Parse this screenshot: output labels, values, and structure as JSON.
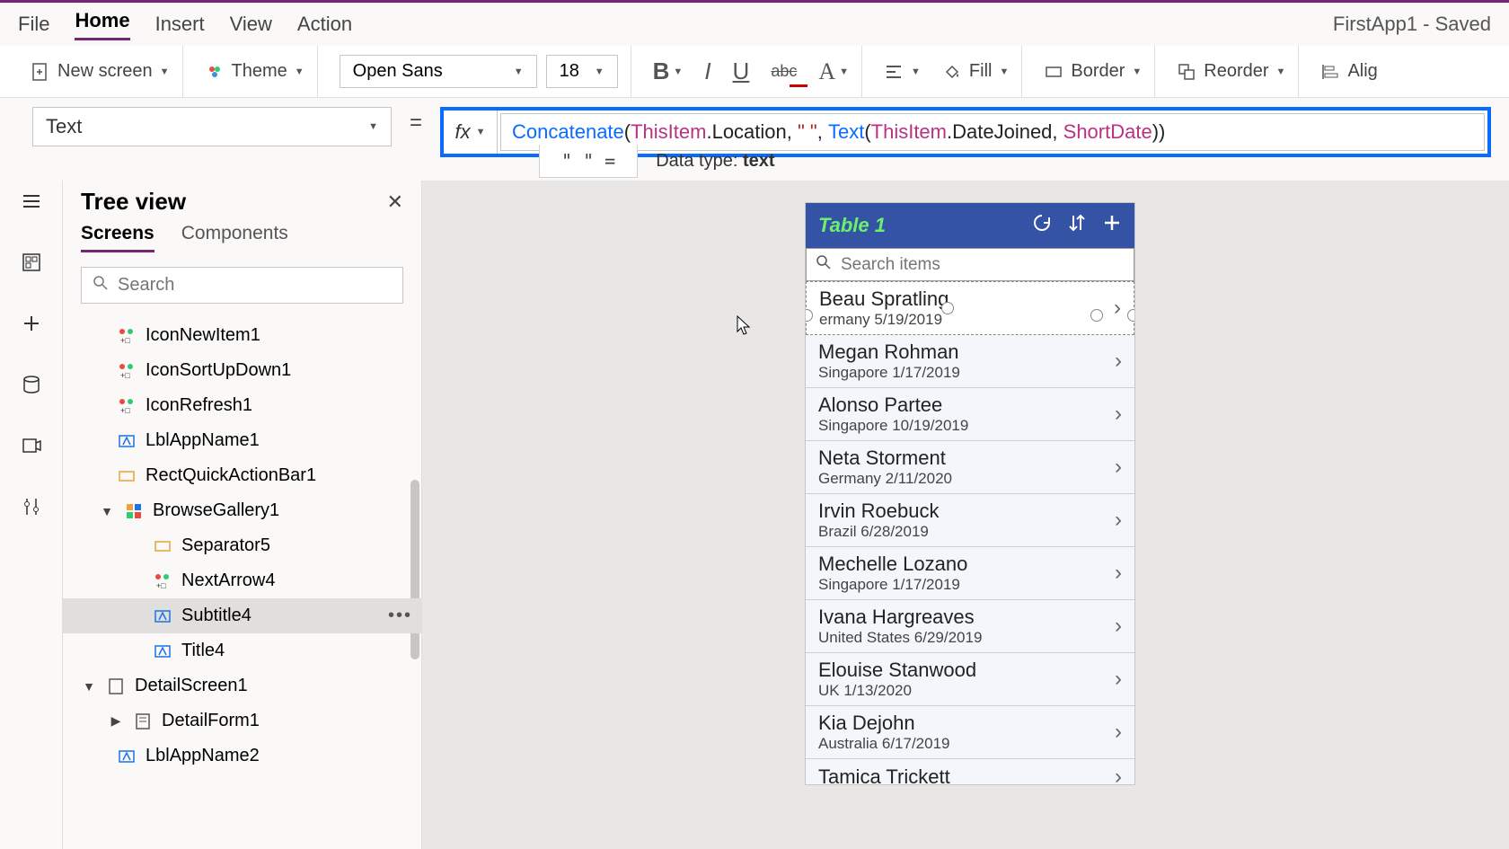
{
  "app": {
    "title": "FirstApp1 - Saved"
  },
  "menu": {
    "file": "File",
    "home": "Home",
    "insert": "Insert",
    "view": "View",
    "action": "Action"
  },
  "ribbon": {
    "newscreen": "New screen",
    "theme": "Theme",
    "font": "Open Sans",
    "size": "18",
    "fill": "Fill",
    "border": "Border",
    "reorder": "Reorder",
    "align": "Alig"
  },
  "propbar": {
    "property": "Text"
  },
  "formula": {
    "fn1": "Concatenate",
    "p1": "(",
    "kw1": "ThisItem",
    "m1": ".Location, ",
    "str1": "\" \"",
    "m2": ", ",
    "fn2": "Text",
    "p2": "(",
    "kw2": "ThisItem",
    "m3": ".DateJoined, ",
    "kw3": "ShortDate",
    "p3": "))"
  },
  "intel": {
    "pill": "\" \"  =",
    "typelabel": "Data type: ",
    "type": "text"
  },
  "tree": {
    "title": "Tree view",
    "tabs": {
      "screens": "Screens",
      "components": "Components"
    },
    "search_placeholder": "Search",
    "items": {
      "iconnew": "IconNewItem1",
      "iconsort": "IconSortUpDown1",
      "iconrefresh": "IconRefresh1",
      "lblapp": "LblAppName1",
      "rect": "RectQuickActionBar1",
      "gallery": "BrowseGallery1",
      "sep": "Separator5",
      "nextarrow": "NextArrow4",
      "subtitle": "Subtitle4",
      "title4": "Title4",
      "detailscreen": "DetailScreen1",
      "detailform": "DetailForm1",
      "lblapp2": "LblAppName2"
    }
  },
  "phone": {
    "header": "Table 1",
    "search_placeholder": "Search items",
    "list": [
      {
        "title": "Beau Spratling",
        "sub": "ermany 5/19/2019",
        "selected": true
      },
      {
        "title": "Megan Rohman",
        "sub": "Singapore 1/17/2019"
      },
      {
        "title": "Alonso Partee",
        "sub": "Singapore 10/19/2019"
      },
      {
        "title": "Neta Storment",
        "sub": "Germany 2/11/2020"
      },
      {
        "title": "Irvin Roebuck",
        "sub": "Brazil 6/28/2019"
      },
      {
        "title": "Mechelle Lozano",
        "sub": "Singapore 1/17/2019"
      },
      {
        "title": "Ivana Hargreaves",
        "sub": "United States 6/29/2019"
      },
      {
        "title": "Elouise Stanwood",
        "sub": "UK 1/13/2020"
      },
      {
        "title": "Kia Dejohn",
        "sub": "Australia 6/17/2019"
      },
      {
        "title": "Tamica Trickett",
        "sub": ""
      }
    ]
  }
}
